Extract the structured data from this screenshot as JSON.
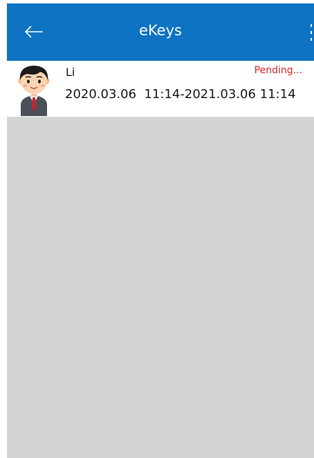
{
  "header": {
    "title": "eKeys",
    "colors": {
      "bar": "#0d73c2",
      "text": "#ffffff"
    },
    "back_icon": "arrow-left-icon",
    "menu_icon": "more-vertical-icon"
  },
  "ekeys": [
    {
      "name": "Li",
      "status": "Pending...",
      "validity": "2020.03.06  11:14-2021.03.06 11:14",
      "avatar_icon": "businessman-avatar"
    }
  ],
  "colors": {
    "status_pending": "#e0242a",
    "list_background": "#d3d4d6"
  }
}
